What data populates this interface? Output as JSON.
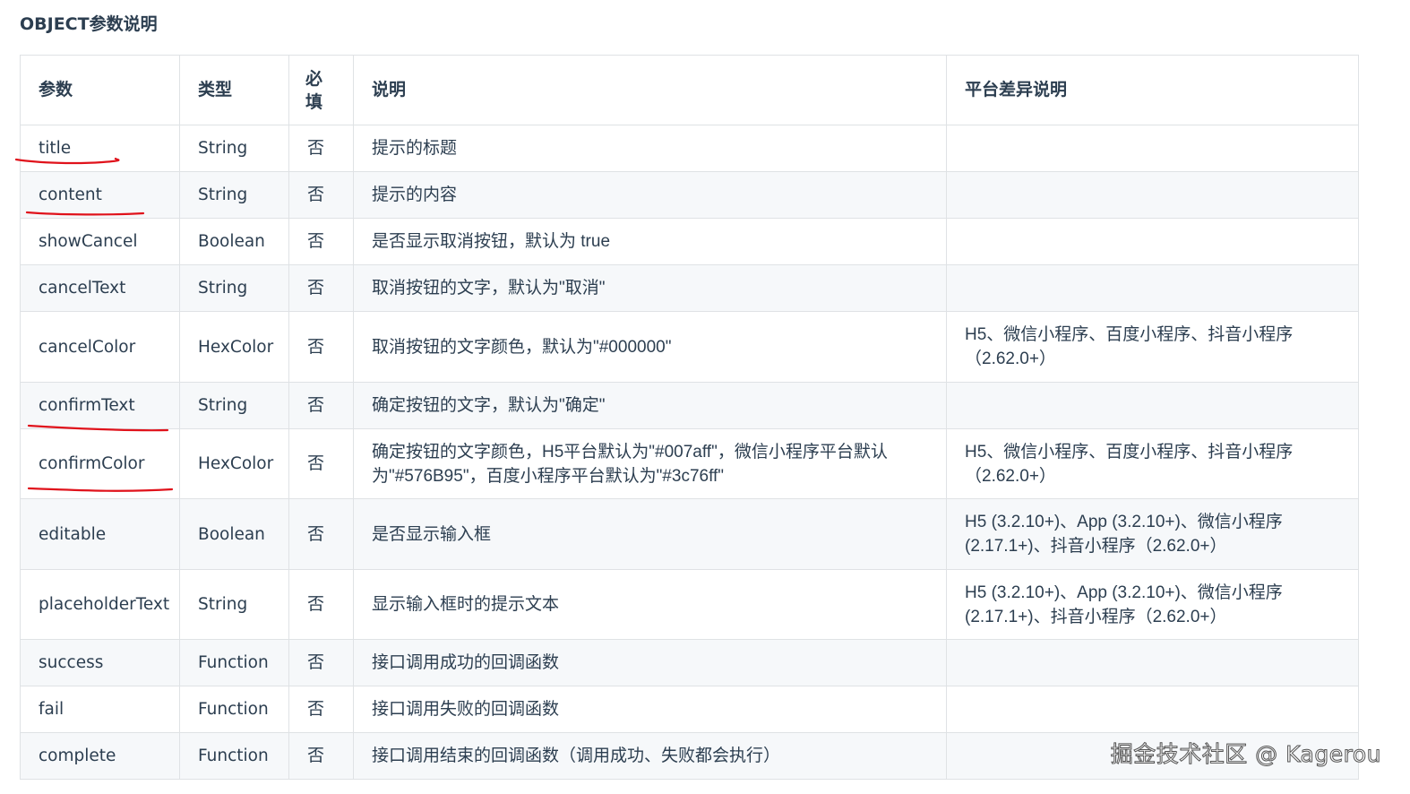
{
  "heading": "OBJECT参数说明",
  "headers": [
    "参数",
    "类型",
    "必填",
    "说明",
    "平台差异说明"
  ],
  "rows": [
    {
      "param": "title",
      "type": "String",
      "required": "否",
      "desc": "提示的标题",
      "platform": ""
    },
    {
      "param": "content",
      "type": "String",
      "required": "否",
      "desc": "提示的内容",
      "platform": ""
    },
    {
      "param": "showCancel",
      "type": "Boolean",
      "required": "否",
      "desc": "是否显示取消按钮，默认为 true",
      "platform": ""
    },
    {
      "param": "cancelText",
      "type": "String",
      "required": "否",
      "desc": "取消按钮的文字，默认为\"取消\"",
      "platform": ""
    },
    {
      "param": "cancelColor",
      "type": "HexColor",
      "required": "否",
      "desc": "取消按钮的文字颜色，默认为\"#000000\"",
      "platform": "H5、微信小程序、百度小程序、抖音小程序（2.62.0+）"
    },
    {
      "param": "confirmText",
      "type": "String",
      "required": "否",
      "desc": "确定按钮的文字，默认为\"确定\"",
      "platform": ""
    },
    {
      "param": "confirmColor",
      "type": "HexColor",
      "required": "否",
      "desc": "确定按钮的文字颜色，H5平台默认为\"#007aff\"，微信小程序平台默认为\"#576B95\"，百度小程序平台默认为\"#3c76ff\"",
      "platform": "H5、微信小程序、百度小程序、抖音小程序（2.62.0+）"
    },
    {
      "param": "editable",
      "type": "Boolean",
      "required": "否",
      "desc": "是否显示输入框",
      "platform": "H5 (3.2.10+)、App (3.2.10+)、微信小程序 (2.17.1+)、抖音小程序（2.62.0+）"
    },
    {
      "param": "placeholderText",
      "type": "String",
      "required": "否",
      "desc": "显示输入框时的提示文本",
      "platform": "H5 (3.2.10+)、App (3.2.10+)、微信小程序 (2.17.1+)、抖音小程序（2.62.0+）"
    },
    {
      "param": "success",
      "type": "Function",
      "required": "否",
      "desc": "接口调用成功的回调函数",
      "platform": ""
    },
    {
      "param": "fail",
      "type": "Function",
      "required": "否",
      "desc": "接口调用失败的回调函数",
      "platform": ""
    },
    {
      "param": "complete",
      "type": "Function",
      "required": "否",
      "desc": "接口调用结束的回调函数（调用成功、失败都会执行）",
      "platform": ""
    }
  ],
  "annotation_color": "#e0121b",
  "watermark": "掘金技术社区 @ Kagerou"
}
